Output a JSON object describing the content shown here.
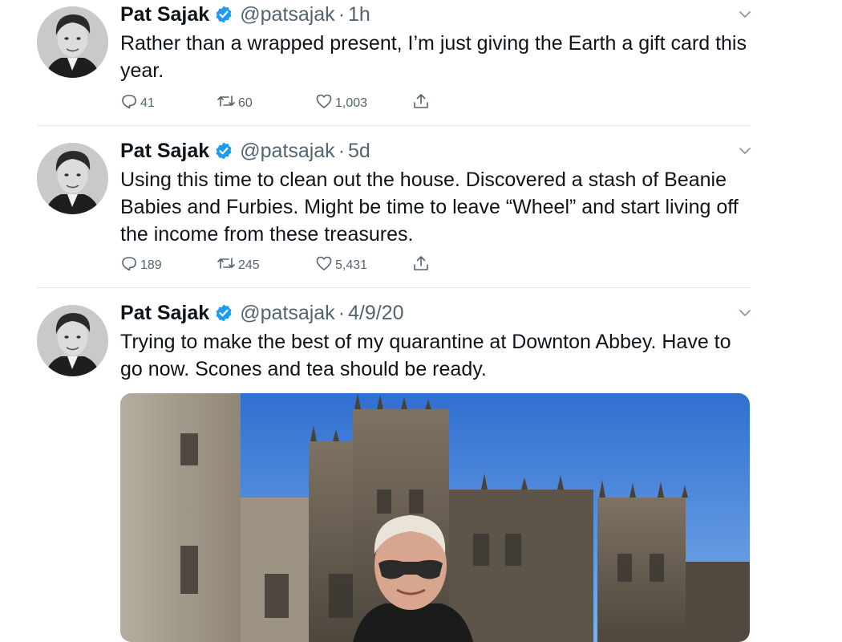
{
  "tweets": [
    {
      "name": "Pat Sajak",
      "handle": "@patsajak",
      "time": "1h",
      "text": "Rather than a wrapped present, I’m just giving the Earth a gift card this year.",
      "replies": "41",
      "retweets": "60",
      "likes": "1,003"
    },
    {
      "name": "Pat Sajak",
      "handle": "@patsajak",
      "time": "5d",
      "text": "Using this time to clean out the house. Discovered a stash of Beanie Babies and Furbies. Might be time to leave “Wheel” and start living off the income from these treasures.",
      "replies": "189",
      "retweets": "245",
      "likes": "5,431"
    },
    {
      "name": "Pat Sajak",
      "handle": "@patsajak",
      "time": "4/9/20",
      "text": "Trying to make the best of my quarantine at Downton Abbey. Have to go now. Scones and tea should be ready."
    }
  ],
  "ui": {
    "separator": "·",
    "verified_color": "#1d9bf0",
    "secondary_text_color": "#536471",
    "icons": [
      "reply-icon",
      "retweet-icon",
      "like-icon",
      "share-icon",
      "chevron-down-icon",
      "verified-badge-icon"
    ]
  }
}
